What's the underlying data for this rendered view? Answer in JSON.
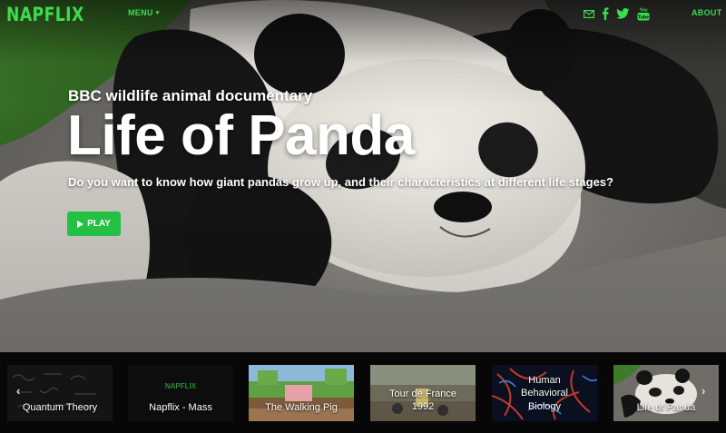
{
  "brand": {
    "logo": "NAPFLIX",
    "accent": "#3ddc4f",
    "play_color": "#23c043"
  },
  "nav": {
    "menu_label": "MENU",
    "menu_caret": "▾",
    "about_label": "ABOUT",
    "social": [
      {
        "icon": "email-icon"
      },
      {
        "icon": "facebook-icon"
      },
      {
        "icon": "twitter-icon"
      },
      {
        "icon": "youtube-icon",
        "text": "You Tube"
      }
    ]
  },
  "hero": {
    "subtitle": "BBC wildlife animal documentary",
    "title": "Life of Panda",
    "description": "Do you want to know how giant pandas grow up, and their characteristics at different life stages?",
    "play_label": "PLAY"
  },
  "carousel": {
    "prev_arrow": "‹",
    "next_arrow": "›",
    "items": [
      {
        "label": "Quantum Theory"
      },
      {
        "label": "Napflix - Mass",
        "logo": "NAPFLIX"
      },
      {
        "label": "The Walking Pig"
      },
      {
        "label_line1": "Tour de France",
        "label_line2": "1992"
      },
      {
        "label_line1": "Human",
        "label_line2": "Behavioral",
        "label_line3": "Biology"
      },
      {
        "label": "Life of Panda"
      }
    ]
  }
}
